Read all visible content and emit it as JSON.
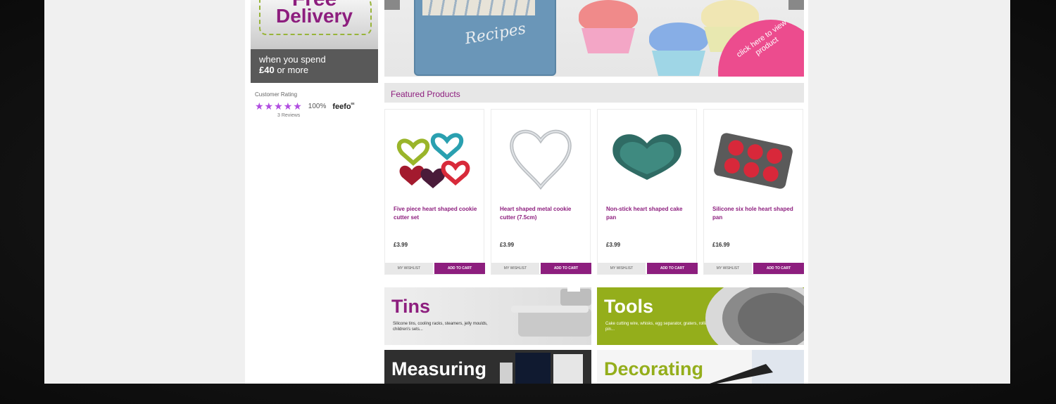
{
  "sidebar": {
    "delivery": {
      "line1": "Free",
      "line2": "Delivery",
      "subline1": "when you spend",
      "amount": "£40",
      "subline2_rest": " or more"
    },
    "rating": {
      "label": "Customer Rating",
      "stars": "★★★★★",
      "percent": "100%",
      "brand": "feefo",
      "brand_sup": "ᴱᴱ",
      "reviews": "3 Reviews"
    }
  },
  "banner": {
    "tin_label": "Recipes",
    "cta": "click here to view product"
  },
  "featured": {
    "title": "Featured Products",
    "products": [
      {
        "name": "Five piece heart shaped cookie cutter set",
        "price": "£3.99",
        "wishlist": "MY WISHLIST",
        "add_to_cart": "ADD TO CART"
      },
      {
        "name": "Heart shaped metal cookie cutter (7.5cm)",
        "price": "£3.99",
        "wishlist": "MY WISHLIST",
        "add_to_cart": "ADD TO CART"
      },
      {
        "name": "Non-stick heart shaped cake pan",
        "price": "£3.99",
        "wishlist": "MY WISHLIST",
        "add_to_cart": "ADD TO CART"
      },
      {
        "name": "Silicone six hole heart shaped pan",
        "price": "£16.99",
        "wishlist": "MY WISHLIST",
        "add_to_cart": "ADD TO CART"
      }
    ]
  },
  "categories": {
    "tins": {
      "title": "Tins",
      "desc": "Silicone tins, cooling racks, steamers, jelly moulds, children's sets..."
    },
    "tools": {
      "title": "Tools",
      "desc": "Cake cutting wire, whisks, egg separator, graters, rolling pin..."
    },
    "measuring": {
      "title": "Measuring"
    },
    "decorating": {
      "title": "Decorating"
    }
  },
  "colors": {
    "brand": "#8d1e7e",
    "cta": "#ec4c8e",
    "tools": "#94ae1b",
    "stars": "#b04ce0"
  }
}
